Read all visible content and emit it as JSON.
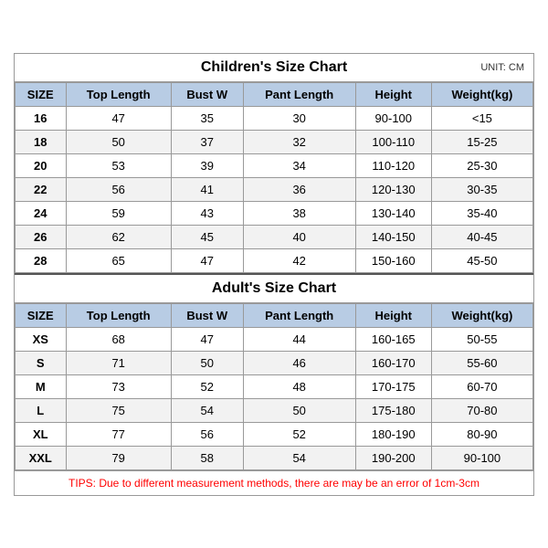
{
  "children_chart": {
    "title": "Children's Size Chart",
    "unit": "UNIT: CM",
    "headers": [
      "SIZE",
      "Top Length",
      "Bust W",
      "Pant Length",
      "Height",
      "Weight(kg)"
    ],
    "rows": [
      [
        "16",
        "47",
        "35",
        "30",
        "90-100",
        "<15"
      ],
      [
        "18",
        "50",
        "37",
        "32",
        "100-110",
        "15-25"
      ],
      [
        "20",
        "53",
        "39",
        "34",
        "110-120",
        "25-30"
      ],
      [
        "22",
        "56",
        "41",
        "36",
        "120-130",
        "30-35"
      ],
      [
        "24",
        "59",
        "43",
        "38",
        "130-140",
        "35-40"
      ],
      [
        "26",
        "62",
        "45",
        "40",
        "140-150",
        "40-45"
      ],
      [
        "28",
        "65",
        "47",
        "42",
        "150-160",
        "45-50"
      ]
    ]
  },
  "adult_chart": {
    "title": "Adult's Size Chart",
    "headers": [
      "SIZE",
      "Top Length",
      "Bust W",
      "Pant Length",
      "Height",
      "Weight(kg)"
    ],
    "rows": [
      [
        "XS",
        "68",
        "47",
        "44",
        "160-165",
        "50-55"
      ],
      [
        "S",
        "71",
        "50",
        "46",
        "160-170",
        "55-60"
      ],
      [
        "M",
        "73",
        "52",
        "48",
        "170-175",
        "60-70"
      ],
      [
        "L",
        "75",
        "54",
        "50",
        "175-180",
        "70-80"
      ],
      [
        "XL",
        "77",
        "56",
        "52",
        "180-190",
        "80-90"
      ],
      [
        "XXL",
        "79",
        "58",
        "54",
        "190-200",
        "90-100"
      ]
    ]
  },
  "tips": "TIPS: Due to different measurement methods, there are may be an error of 1cm-3cm"
}
